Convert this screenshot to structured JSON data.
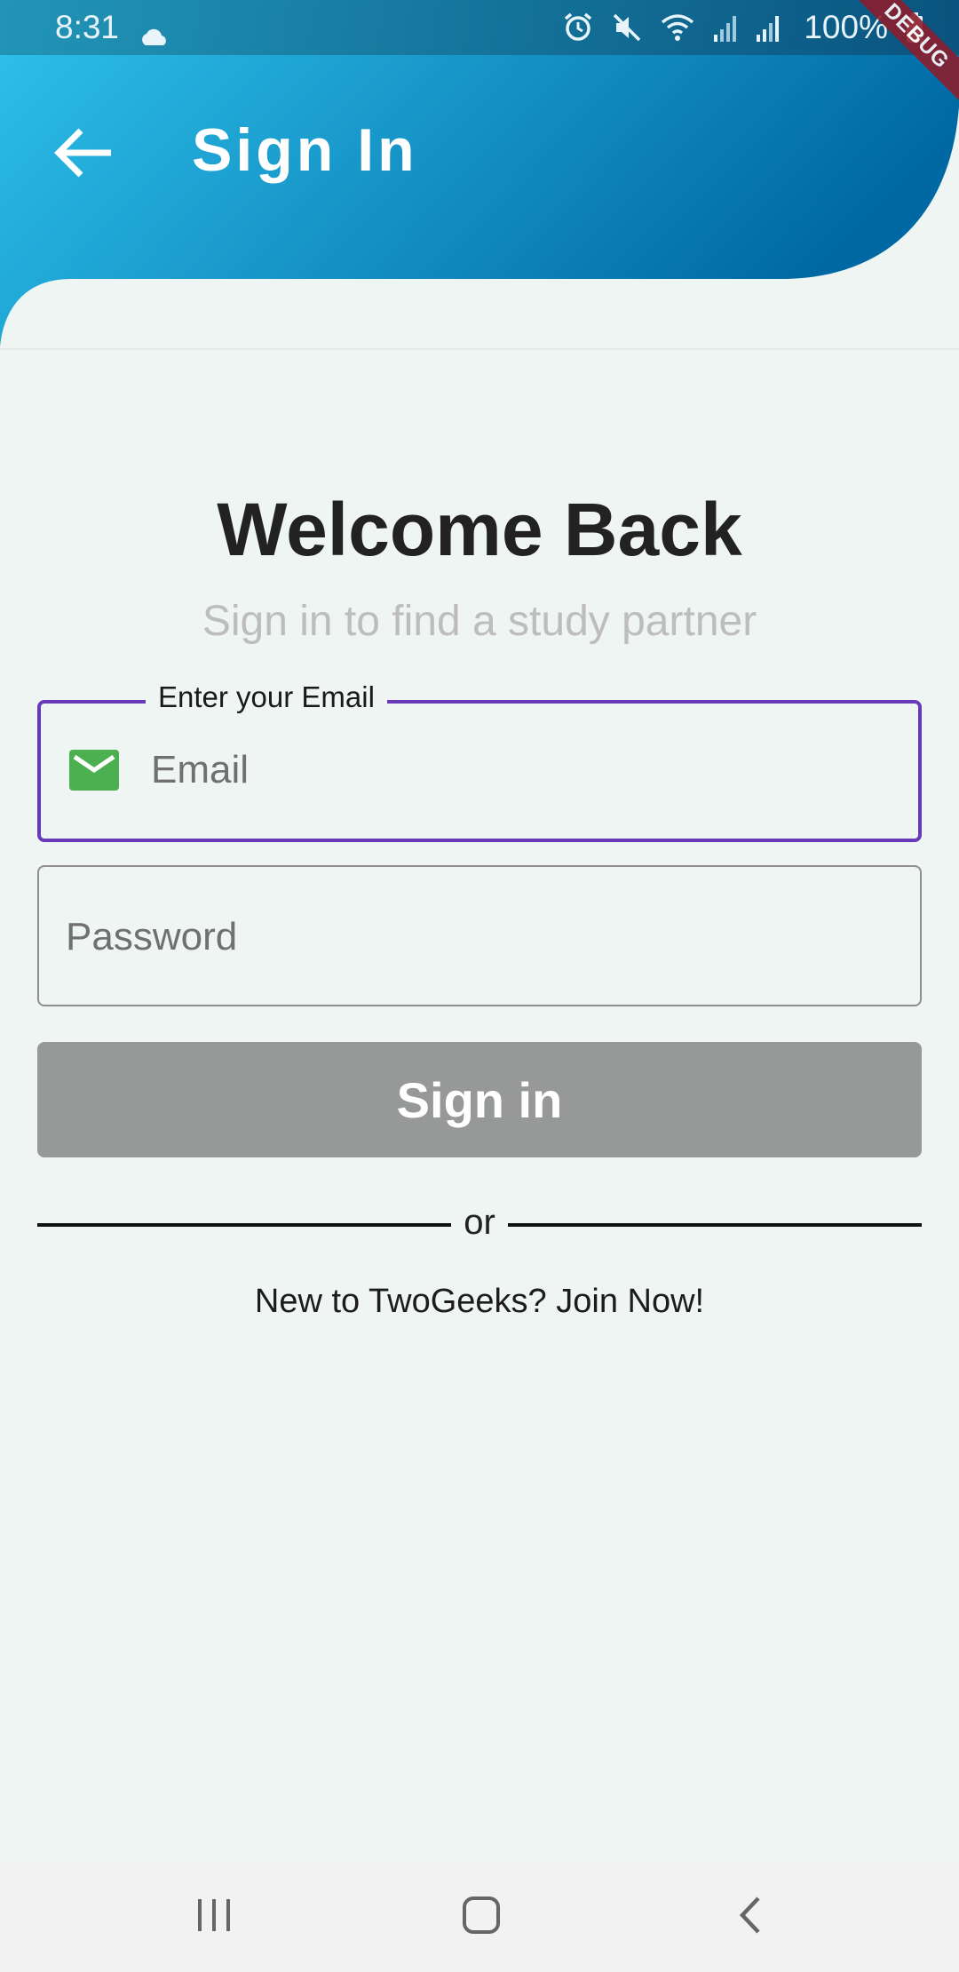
{
  "status_bar": {
    "time": "8:31",
    "battery": "100%"
  },
  "debug_banner": "DEBUG",
  "app_bar": {
    "title": "Sign In"
  },
  "main": {
    "heading": "Welcome Back",
    "subheading": "Sign in to find a study partner",
    "email_field": {
      "label": "Enter your Email",
      "placeholder": "Email",
      "icon": "mail-icon"
    },
    "password_field": {
      "placeholder": "Password"
    },
    "sign_in_button": "Sign in",
    "divider_text": "or",
    "join_link": "New to TwoGeeks? Join Now!"
  },
  "colors": {
    "header_gradient_start": "#2ec2ec",
    "header_gradient_end": "#0069a4",
    "focus_border": "#673ab7",
    "mail_icon": "#4caf50",
    "button_disabled": "#979898",
    "background": "#eff5f3"
  }
}
